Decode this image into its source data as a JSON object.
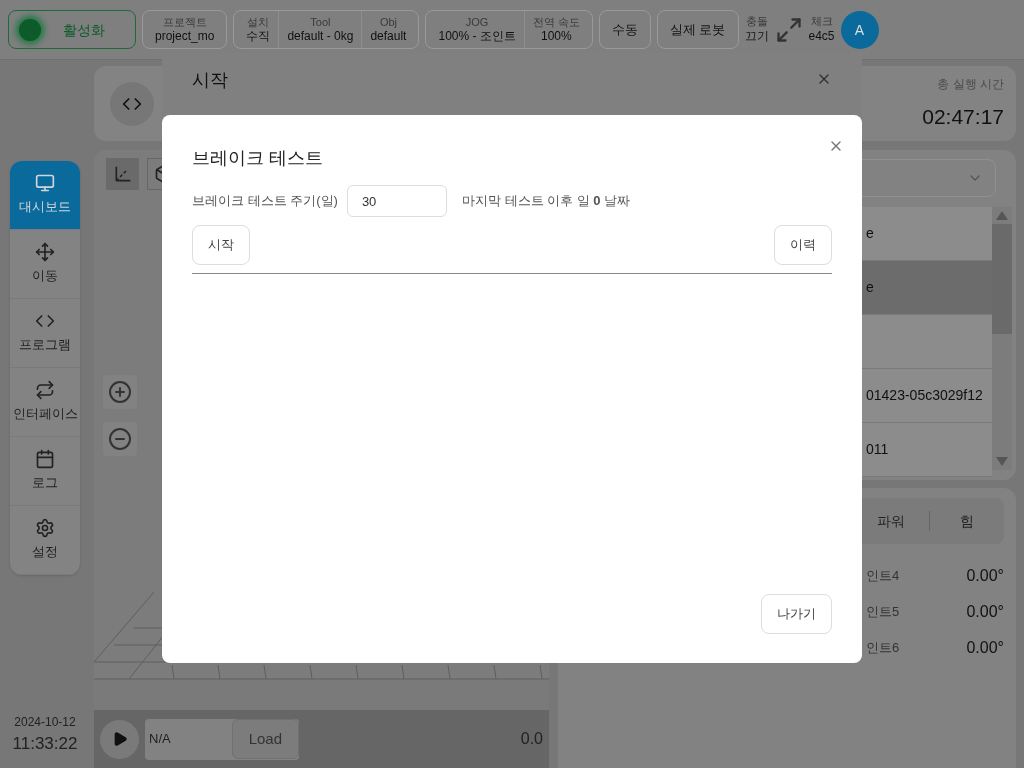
{
  "top_bar": {
    "activate_button": {
      "label": "활성화",
      "on": true
    },
    "status_groups": [
      {
        "items": [
          {
            "label": "프로젝트",
            "value": "project_mo"
          }
        ]
      },
      {
        "items": [
          {
            "label": "설치",
            "value": "수직"
          },
          {
            "label": "Tool",
            "value": "default - 0kg"
          },
          {
            "label": "Obj",
            "value": "default"
          }
        ]
      },
      {
        "items": [
          {
            "label": "JOG",
            "value": "100% - 조인트"
          },
          {
            "label": "전역 속도",
            "value": "100%"
          }
        ]
      }
    ],
    "mode_buttons": [
      "수동",
      "실제 로봇"
    ],
    "collision": {
      "label": "충돌",
      "value": "끄기"
    },
    "check": {
      "label": "체크",
      "value": "e4c5"
    },
    "avatar": "A"
  },
  "sidebar": {
    "items": [
      {
        "label": "대시보드",
        "selected": true
      },
      {
        "label": "이동",
        "selected": false
      },
      {
        "label": "프로그램",
        "selected": false
      },
      {
        "label": "인터페이스",
        "selected": false
      },
      {
        "label": "로그",
        "selected": false
      },
      {
        "label": "설정",
        "selected": false
      }
    ]
  },
  "clock": {
    "date": "2024-10-12",
    "time": "11:33:22"
  },
  "runtime": {
    "label": "총 실행 시간",
    "value": "02:47:17"
  },
  "program_list": {
    "rows": [
      {
        "text": "e",
        "selected": false
      },
      {
        "text": "e",
        "selected": true
      },
      {
        "selected": false
      },
      {
        "text": "01423-05c3029f12",
        "selected": false
      },
      {
        "text": "011",
        "selected": false
      }
    ]
  },
  "tabs": [
    {
      "label": "파워"
    },
    {
      "label": "힘"
    }
  ],
  "joints": [
    {
      "name": "인트4",
      "value": "0.00°"
    },
    {
      "name": "인트5",
      "value": "0.00°"
    },
    {
      "name": "인트6",
      "value": "0.00°"
    }
  ],
  "player": {
    "file": "N/A",
    "load_button": "Load",
    "value": "0.0"
  },
  "back_dialog": {
    "title": "시작"
  },
  "dialog": {
    "title": "브레이크 테스트",
    "period_label": "브레이크 테스트 주기(일)",
    "period_value": "30",
    "last_test": "마지막 테스트 이후 일 **0** 날짜",
    "start_button": "시작",
    "history_button": "이력",
    "exit_button": "나가기"
  }
}
